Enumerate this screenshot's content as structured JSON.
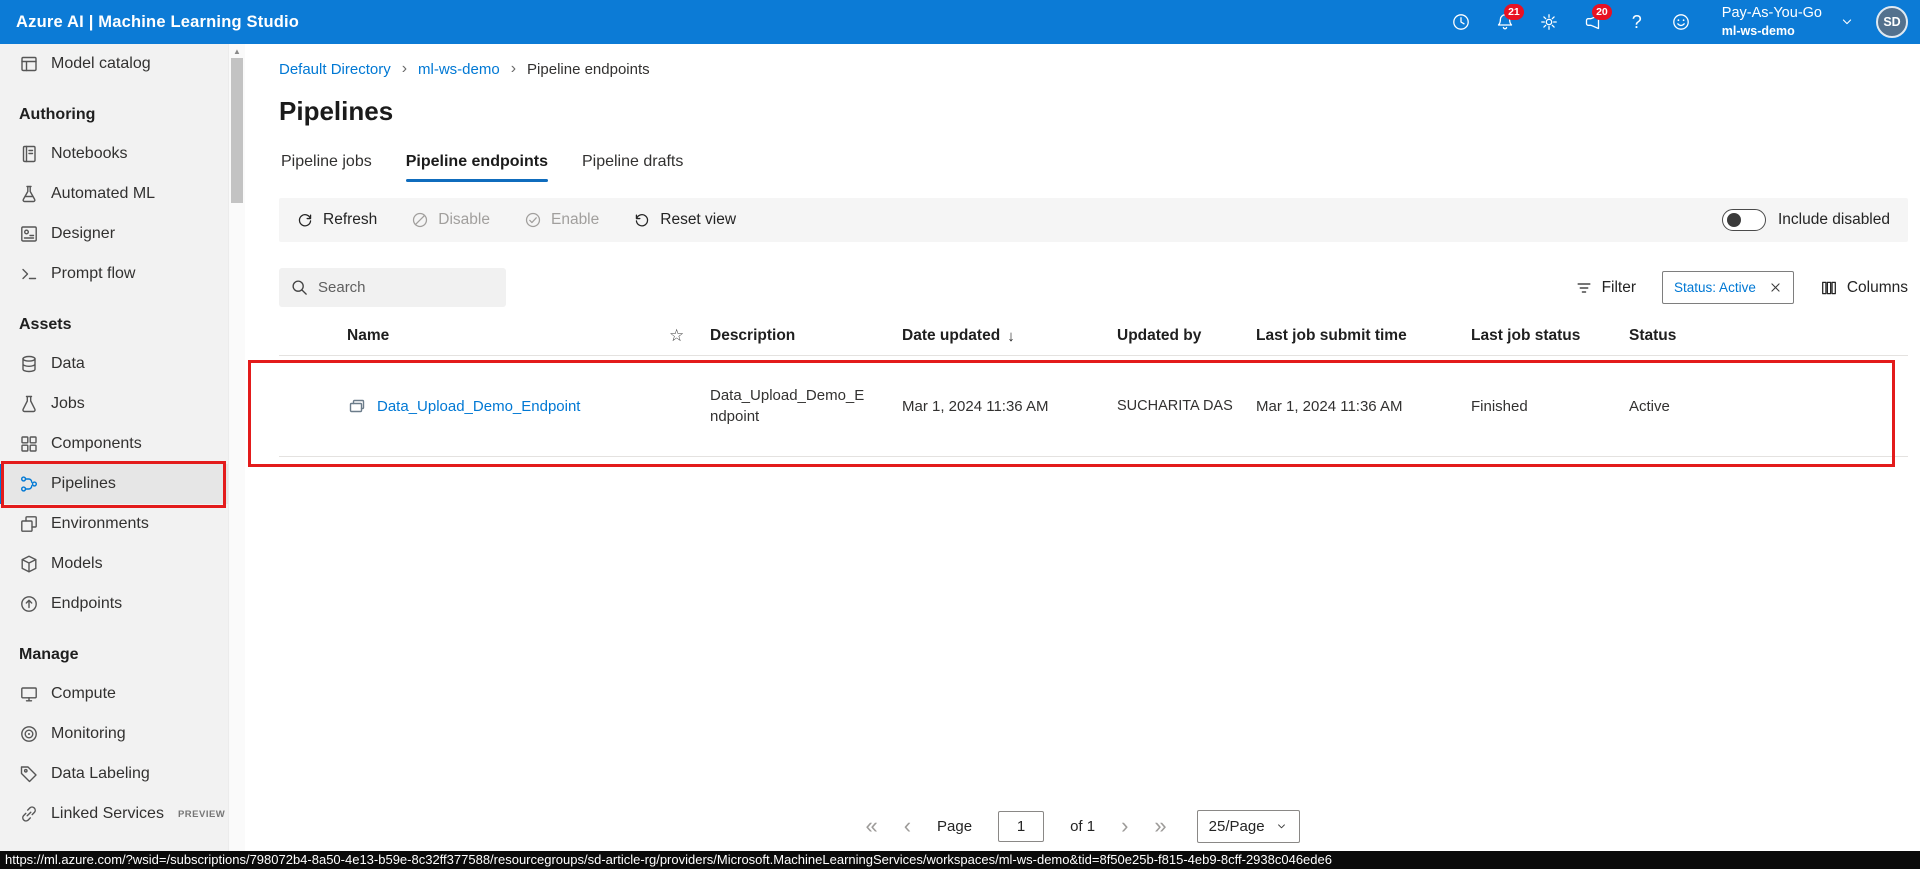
{
  "topbar": {
    "title": "Azure AI | Machine Learning Studio",
    "bell_badge": "21",
    "megaphone_badge": "20",
    "help_label": "?",
    "icon_names": [
      "history-icon",
      "notifications-bell-icon",
      "settings-gear-icon",
      "announcements-megaphone-icon",
      "help-icon",
      "feedback-smiley-icon"
    ],
    "account": {
      "plan": "Pay-As-You-Go",
      "workspace": "ml-ws-demo",
      "avatar_initials": "SD"
    }
  },
  "sidebar": {
    "top_items": [
      {
        "label": "Model catalog",
        "icon": "model-catalog-icon"
      }
    ],
    "sections": [
      {
        "heading": "Authoring",
        "items": [
          {
            "label": "Notebooks",
            "icon": "notebook-icon"
          },
          {
            "label": "Automated ML",
            "icon": "automated-ml-icon"
          },
          {
            "label": "Designer",
            "icon": "designer-icon"
          },
          {
            "label": "Prompt flow",
            "icon": "prompt-flow-icon"
          }
        ]
      },
      {
        "heading": "Assets",
        "items": [
          {
            "label": "Data",
            "icon": "data-icon"
          },
          {
            "label": "Jobs",
            "icon": "jobs-icon"
          },
          {
            "label": "Components",
            "icon": "components-icon"
          },
          {
            "label": "Pipelines",
            "icon": "pipelines-icon",
            "selected": true
          },
          {
            "label": "Environments",
            "icon": "environments-icon"
          },
          {
            "label": "Models",
            "icon": "models-icon"
          },
          {
            "label": "Endpoints",
            "icon": "endpoints-icon"
          }
        ]
      },
      {
        "heading": "Manage",
        "items": [
          {
            "label": "Compute",
            "icon": "compute-icon"
          },
          {
            "label": "Monitoring",
            "icon": "monitoring-icon"
          },
          {
            "label": "Data Labeling",
            "icon": "data-labeling-icon"
          },
          {
            "label": "Linked Services",
            "icon": "linked-services-icon",
            "badge": "PREVIEW"
          }
        ]
      }
    ]
  },
  "breadcrumb": {
    "items": [
      "Default Directory",
      "ml-ws-demo",
      "Pipeline endpoints"
    ]
  },
  "page": {
    "title": "Pipelines"
  },
  "tabs": {
    "items": [
      "Pipeline jobs",
      "Pipeline endpoints",
      "Pipeline drafts"
    ],
    "active": "Pipeline endpoints"
  },
  "commandbar": {
    "refresh": "Refresh",
    "disable": "Disable",
    "enable": "Enable",
    "reset_view": "Reset view",
    "include_disabled": "Include disabled",
    "include_disabled_state": "off"
  },
  "filter_row": {
    "search_placeholder": "Search",
    "filter": "Filter",
    "status_chip": "Status: Active",
    "columns": "Columns"
  },
  "table": {
    "headers": [
      "Name",
      "Description",
      "Date updated",
      "Updated by",
      "Last job submit time",
      "Last job status",
      "Status"
    ],
    "sort_column": "Date updated",
    "sort_direction": "desc",
    "rows": [
      {
        "name": "Data_Upload_Demo_Endpoint",
        "description": "Data_Upload_Demo_Endpoint",
        "date_updated": "Mar 1, 2024 11:36 AM",
        "updated_by": "SUCHARITA DAS",
        "last_job_submit_time": "Mar 1, 2024 11:36 AM",
        "last_job_status": "Finished",
        "status": "Active"
      }
    ]
  },
  "pagination": {
    "page_label": "Page",
    "page_value": "1",
    "of_label": "of 1",
    "page_size": "25/Page"
  },
  "statusbar": {
    "url": "https://ml.azure.com/?wsid=/subscriptions/798072b4-8a50-4e13-b59e-8c32ff377588/resourcegroups/sd-article-rg/providers/Microsoft.MachineLearningServices/workspaces/ml-ws-demo&tid=8f50e25b-f815-4eb9-8cff-2938c046ede6"
  },
  "icons": {
    "star": "☆",
    "sort_desc": "↓",
    "breadcrumb_separator": "›",
    "scroll_up": "▲",
    "pagination_first": "«",
    "pagination_prev": "‹",
    "pagination_next": "›",
    "pagination_last": "»"
  },
  "annotations": [
    {
      "target": "sidebar-pipelines-item",
      "color": "#e31b1b"
    },
    {
      "target": "pipeline-endpoint-table-row",
      "color": "#e31b1b"
    }
  ],
  "colors": {
    "topbar": "#0c7bd6",
    "accent": "#0078d4",
    "link": "#0078d4",
    "badge": "#e81123",
    "annotation": "#e31b1b"
  }
}
